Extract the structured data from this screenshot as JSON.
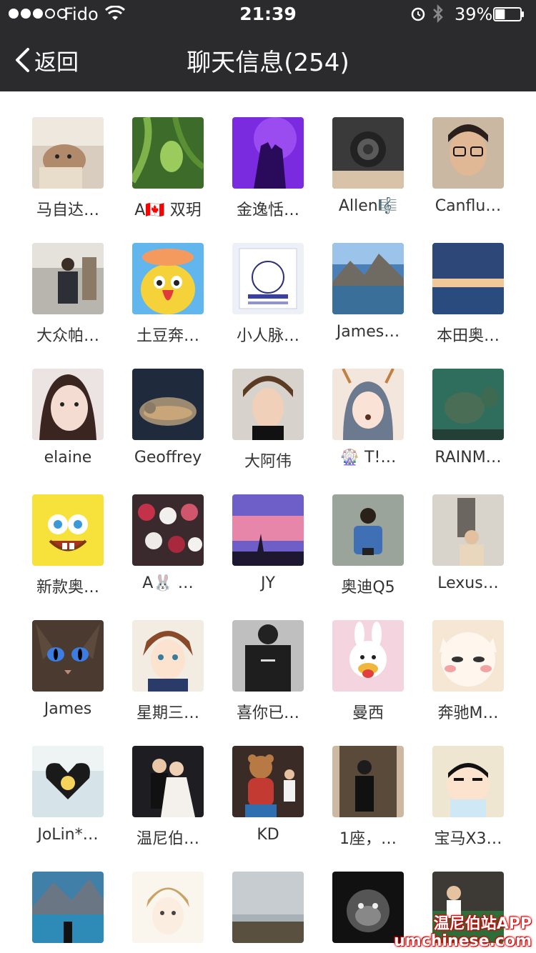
{
  "status_bar": {
    "carrier": "Fido",
    "time": "21:39",
    "battery_percent": "39%",
    "battery_level": 0.39,
    "signal_bars": 3,
    "signal_total": 5
  },
  "nav": {
    "back_label": "返回",
    "title": "聊天信息(254)"
  },
  "members": [
    {
      "name": "马自达…",
      "avatar": "hamster"
    },
    {
      "name": "A🇨🇦 双玥",
      "avatar": "green-plant"
    },
    {
      "name": "金逸恬…",
      "avatar": "purple-couple"
    },
    {
      "name": "Allen🎼",
      "avatar": "rose-tattoo"
    },
    {
      "name": "Canflu…",
      "avatar": "man-glasses"
    },
    {
      "name": "大众帕…",
      "avatar": "man-street"
    },
    {
      "name": "土豆奔…",
      "avatar": "yellow-bird-cartoon"
    },
    {
      "name": "小人脉…",
      "avatar": "qr-poster"
    },
    {
      "name": "James…",
      "avatar": "mountain-lake"
    },
    {
      "name": "本田奥…",
      "avatar": "sunset-sea"
    },
    {
      "name": "elaine",
      "avatar": "girl-portrait"
    },
    {
      "name": "Geoffrey",
      "avatar": "cat-held"
    },
    {
      "name": "大阿伟",
      "avatar": "boy-portrait"
    },
    {
      "name": "🎡 T!…",
      "avatar": "deer-filter-girl"
    },
    {
      "name": "RAINM…",
      "avatar": "fish-aquarium"
    },
    {
      "name": "新款奥…",
      "avatar": "spongebob"
    },
    {
      "name": "A🐰 …",
      "avatar": "flowers"
    },
    {
      "name": "JY",
      "avatar": "pink-sky-silhouette"
    },
    {
      "name": "奥迪Q5",
      "avatar": "man-sitting"
    },
    {
      "name": "Lexus…",
      "avatar": "girl-statue"
    },
    {
      "name": "James",
      "avatar": "cat-blue-eyes"
    },
    {
      "name": "星期三…",
      "avatar": "anime-boy"
    },
    {
      "name": "喜你已…",
      "avatar": "bw-jacket"
    },
    {
      "name": "曼西",
      "avatar": "bunny-toy"
    },
    {
      "name": "奔驰M…",
      "avatar": "cat-cartoon"
    },
    {
      "name": "JoLin*…",
      "avatar": "heart-hands"
    },
    {
      "name": "温尼伯…",
      "avatar": "wedding"
    },
    {
      "name": "KD",
      "avatar": "teddy-bear"
    },
    {
      "name": "1座，…",
      "avatar": "mirror-selfie"
    },
    {
      "name": "宝马X3…",
      "avatar": "shinchan"
    },
    {
      "name": "",
      "avatar": "lake-mountains"
    },
    {
      "name": "",
      "avatar": "anime-sketch"
    },
    {
      "name": "",
      "avatar": "cloudy-field"
    },
    {
      "name": "",
      "avatar": "monkey-bw"
    },
    {
      "name": "",
      "avatar": "snooker"
    }
  ],
  "watermark": {
    "line1": "温尼伯站APP",
    "line2": "umchinese.com"
  },
  "colors": {
    "nav_background": "#2b2b2d",
    "page_background": "#ffffff",
    "name_text": "#333333",
    "watermark_outline": "#d00000"
  }
}
